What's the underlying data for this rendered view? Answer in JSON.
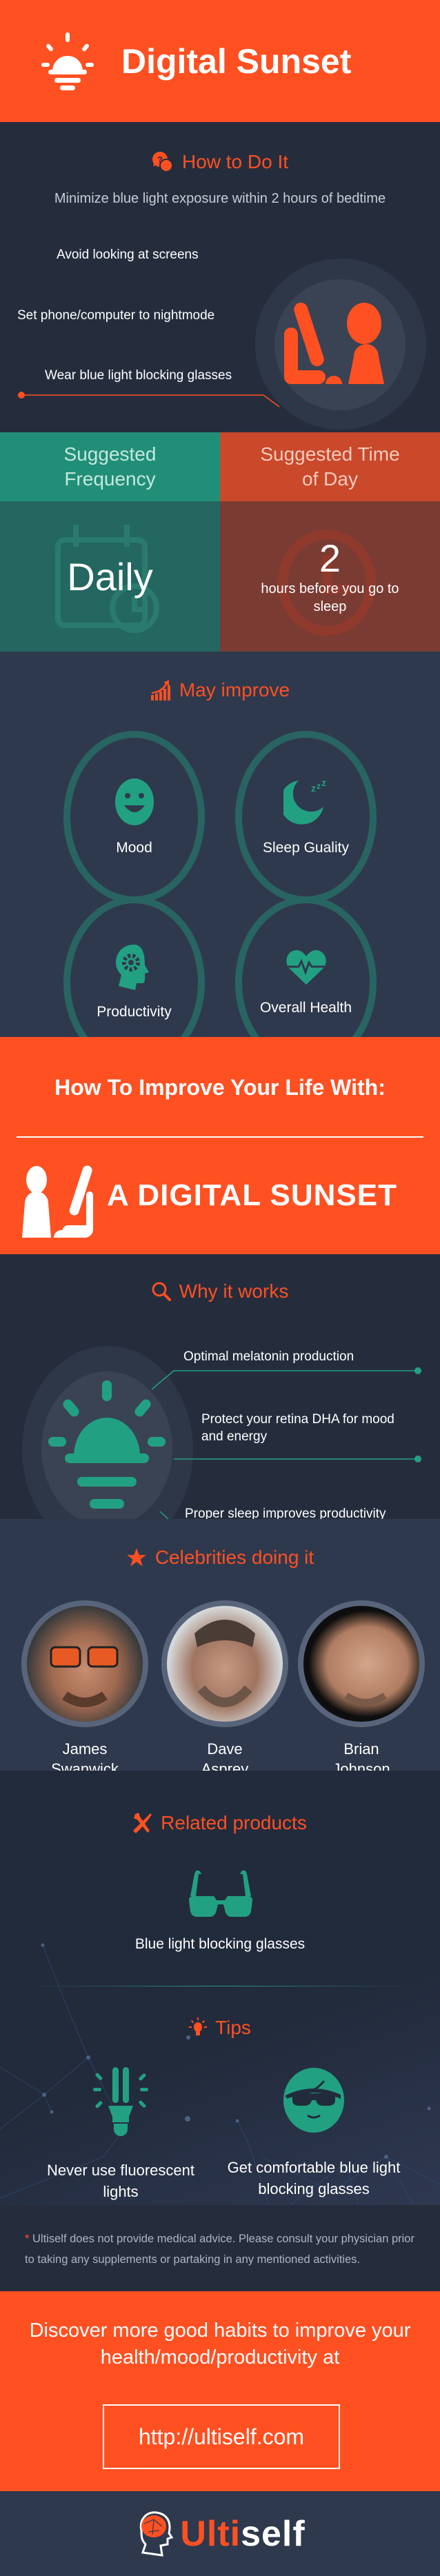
{
  "header": {
    "title": "Digital Sunset",
    "icon": "sunset-icon"
  },
  "how_to": {
    "title": "How to Do It",
    "subtitle": "Minimize blue light exposure within 2 hours of bedtime",
    "items": [
      "Avoid looking at screens",
      "Set phone/computer to nightmode",
      "Wear blue light blocking glasses"
    ]
  },
  "frequency": {
    "label": "Suggested Frequency",
    "value": "Daily"
  },
  "time_of_day": {
    "label": "Suggested Time of Day",
    "value": "2",
    "detail": "hours before you go to sleep"
  },
  "may_improve": {
    "title": "May improve",
    "items": [
      {
        "label": "Mood",
        "icon": "smiley-icon"
      },
      {
        "label": "Sleep Guality",
        "icon": "moon-sleep-icon"
      },
      {
        "label": "Productivity",
        "icon": "head-gear-icon"
      },
      {
        "label": "Overall Health",
        "icon": "heart-pulse-icon"
      }
    ]
  },
  "cta": {
    "heading": "How To Improve Your Life With:",
    "subheading": "A DIGITAL SUNSET"
  },
  "why": {
    "title": "Why it works",
    "items": [
      "Optimal melatonin production",
      "Protect your retina DHA for mood and energy",
      "Proper sleep improves productivity"
    ]
  },
  "celebrities": {
    "title": "Celebrities doing it",
    "people": [
      {
        "first": "James",
        "last": "Swanwick"
      },
      {
        "first": "Dave",
        "last": "Asprey"
      },
      {
        "first": "Brian",
        "last": "Johnson"
      }
    ]
  },
  "products": {
    "title": "Related products",
    "item": "Blue light blocking glasses"
  },
  "tips": {
    "title": "Tips",
    "items": [
      {
        "text": "Never use fluorescent lights",
        "icon": "cfl-bulb-icon"
      },
      {
        "text": "Get comfortable blue light blocking glasses",
        "icon": "face-glasses-icon"
      }
    ]
  },
  "disclaimer": {
    "mark": "*",
    "text": "Ultiself does not provide medical advice. Please consult your physician prior to taking any supplements or partaking in any mentioned activities."
  },
  "cta2": {
    "text": "Discover more good habits to improve your health/mood/productivity at",
    "url": "http://ultiself.com"
  },
  "footer": {
    "logo_part1": "Ulti",
    "logo_part2": "self"
  },
  "colors": {
    "orange": "#ff5022",
    "teal": "#22a182",
    "navy": "#252d3d",
    "slate": "#2f394d"
  }
}
